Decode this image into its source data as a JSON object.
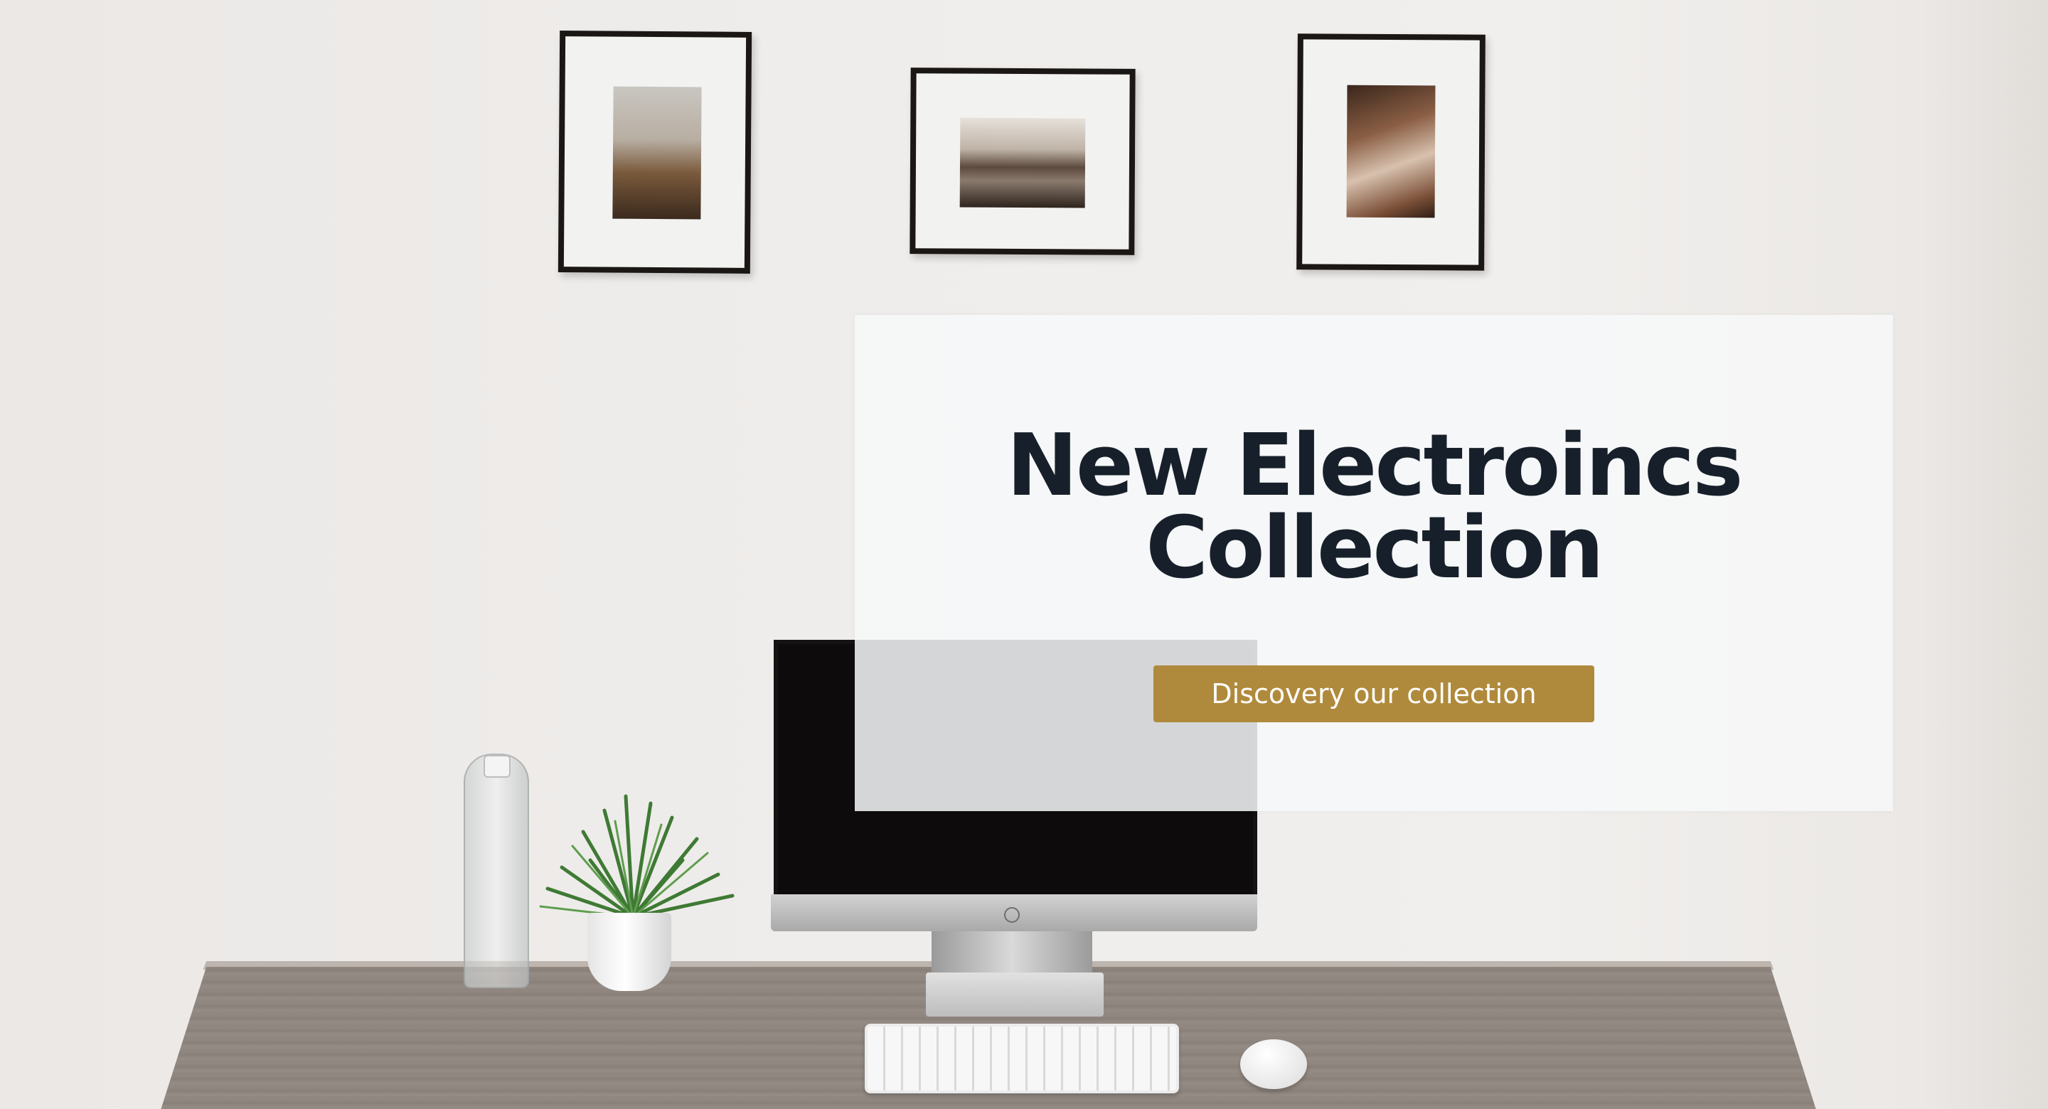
{
  "hero": {
    "title_line1": "New Electroincs",
    "title_line2": "Collection",
    "cta_label": "Discovery our collection"
  },
  "colors": {
    "accent": "#b08a3c",
    "title": "#17202a",
    "panel": "#f7f8f9"
  },
  "icons": {
    "monitor_logo": "hp-logo-icon"
  }
}
